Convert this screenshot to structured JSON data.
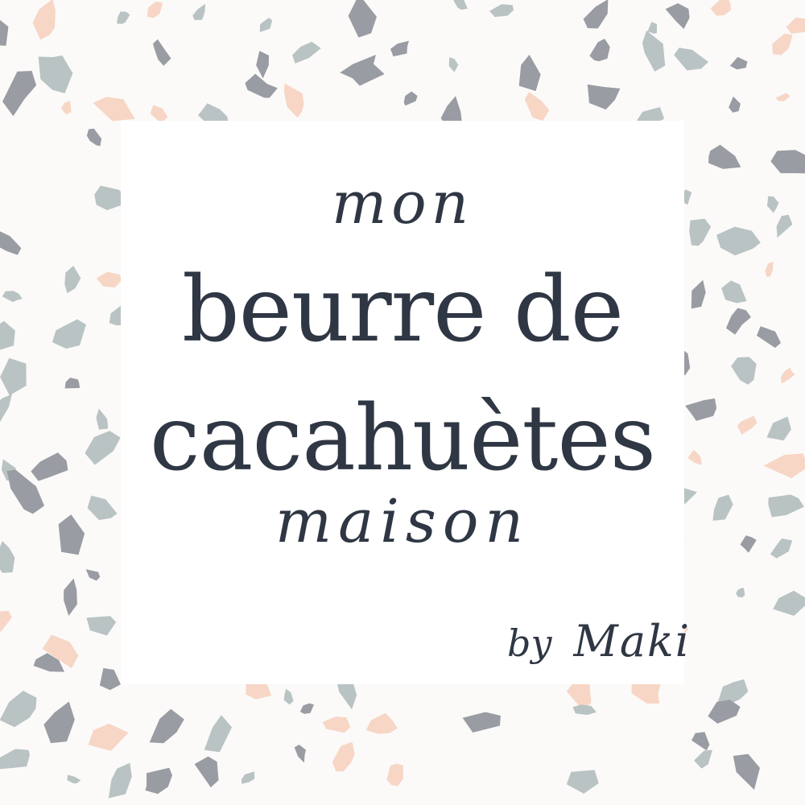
{
  "title": {
    "top_word": "mon",
    "line_1": "beurre de",
    "line_2": "cacahuètes",
    "bottom_word": "maison"
  },
  "byline": {
    "prefix": "by",
    "author": "Maki"
  },
  "colors": {
    "background": "#fbfaf9",
    "card": "#ffffff",
    "text": "#2f3744",
    "chip_grey_dark": "#9a9ca3",
    "chip_grey_blue": "#b9c3c3",
    "chip_peach": "#f7d6c6"
  },
  "decoration": {
    "pattern": "terrazzo-chips"
  }
}
